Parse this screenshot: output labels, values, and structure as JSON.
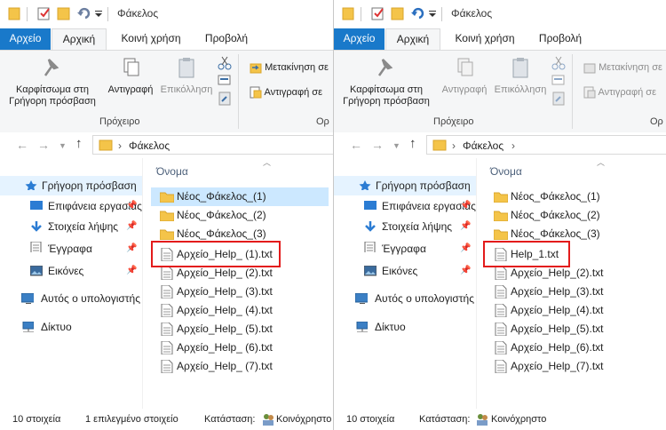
{
  "left": {
    "title": "Φάκελος",
    "tabs": [
      "Αρχείο",
      "Αρχική",
      "Κοινή χρήση",
      "Προβολή"
    ],
    "ribbon": {
      "pin_label_1": "Καρφίτσωμα στη",
      "pin_label_2": "Γρήγορη πρόσβαση",
      "copy_label": "Αντιγραφή",
      "paste_label": "Επικόλληση",
      "move_label": "Μετακίνηση σε",
      "copyto_label": "Αντιγραφή σε",
      "clipboard_group": "Πρόχειρο",
      "organize_group": "Ορ"
    },
    "address": {
      "path": "Φάκελος"
    },
    "nav": {
      "quick_access": "Γρήγορη πρόσβαση",
      "desktop": "Επιφάνεια εργασίας",
      "downloads": "Στοιχεία λήψης",
      "documents": "Έγγραφα",
      "pictures": "Εικόνες",
      "this_pc": "Αυτός ο υπολογιστής",
      "network": "Δίκτυο"
    },
    "column_header": "Όνομα",
    "files": [
      "Νέος_Φάκελος_(1)",
      "Νέος_Φάκελος_(2)",
      "Νέος_Φάκελος_(3)",
      "Αρχείο_Help_ (1).txt",
      "Αρχείο_Help_ (2).txt",
      "Αρχείο_Help_ (3).txt",
      "Αρχείο_Help_ (4).txt",
      "Αρχείο_Help_ (5).txt",
      "Αρχείο_Help_ (6).txt",
      "Αρχείο_Help_ (7).txt"
    ],
    "status": {
      "count": "10 στοιχεία",
      "selected": "1 επιλεγμένο στοιχείο",
      "state": "Κατάσταση:",
      "shared": "Κοινόχρηστο"
    }
  },
  "right": {
    "title": "Φάκελος",
    "tabs": [
      "Αρχείο",
      "Αρχική",
      "Κοινή χρήση",
      "Προβολή"
    ],
    "ribbon": {
      "pin_label_1": "Καρφίτσωμα στη",
      "pin_label_2": "Γρήγορη πρόσβαση",
      "copy_label": "Αντιγραφή",
      "paste_label": "Επικόλληση",
      "move_label": "Μετακίνηση σε",
      "copyto_label": "Αντιγραφή σε",
      "clipboard_group": "Πρόχειρο",
      "organize_group": "Ορ"
    },
    "address": {
      "path": "Φάκελος"
    },
    "nav": {
      "quick_access": "Γρήγορη πρόσβαση",
      "desktop": "Επιφάνεια εργασίας",
      "downloads": "Στοιχεία λήψης",
      "documents": "Έγγραφα",
      "pictures": "Εικόνες",
      "this_pc": "Αυτός ο υπολογιστής",
      "network": "Δίκτυο"
    },
    "column_header": "Όνομα",
    "files": [
      "Νέος_Φάκελος_(1)",
      "Νέος_Φάκελος_(2)",
      "Νέος_Φάκελος_(3)",
      "Help_1.txt",
      "Αρχείο_Help_(2).txt",
      "Αρχείο_Help_(3).txt",
      "Αρχείο_Help_(4).txt",
      "Αρχείο_Help_(5).txt",
      "Αρχείο_Help_(6).txt",
      "Αρχείο_Help_(7).txt"
    ],
    "status": {
      "count": "10 στοιχεία",
      "state": "Κατάσταση:",
      "shared": "Κοινόχρηστο"
    }
  },
  "colors": {
    "file_tab": "#1979ca",
    "highlight": "#e31b1b",
    "selection": "#cce8ff",
    "nav_selection": "#e5f3ff"
  }
}
